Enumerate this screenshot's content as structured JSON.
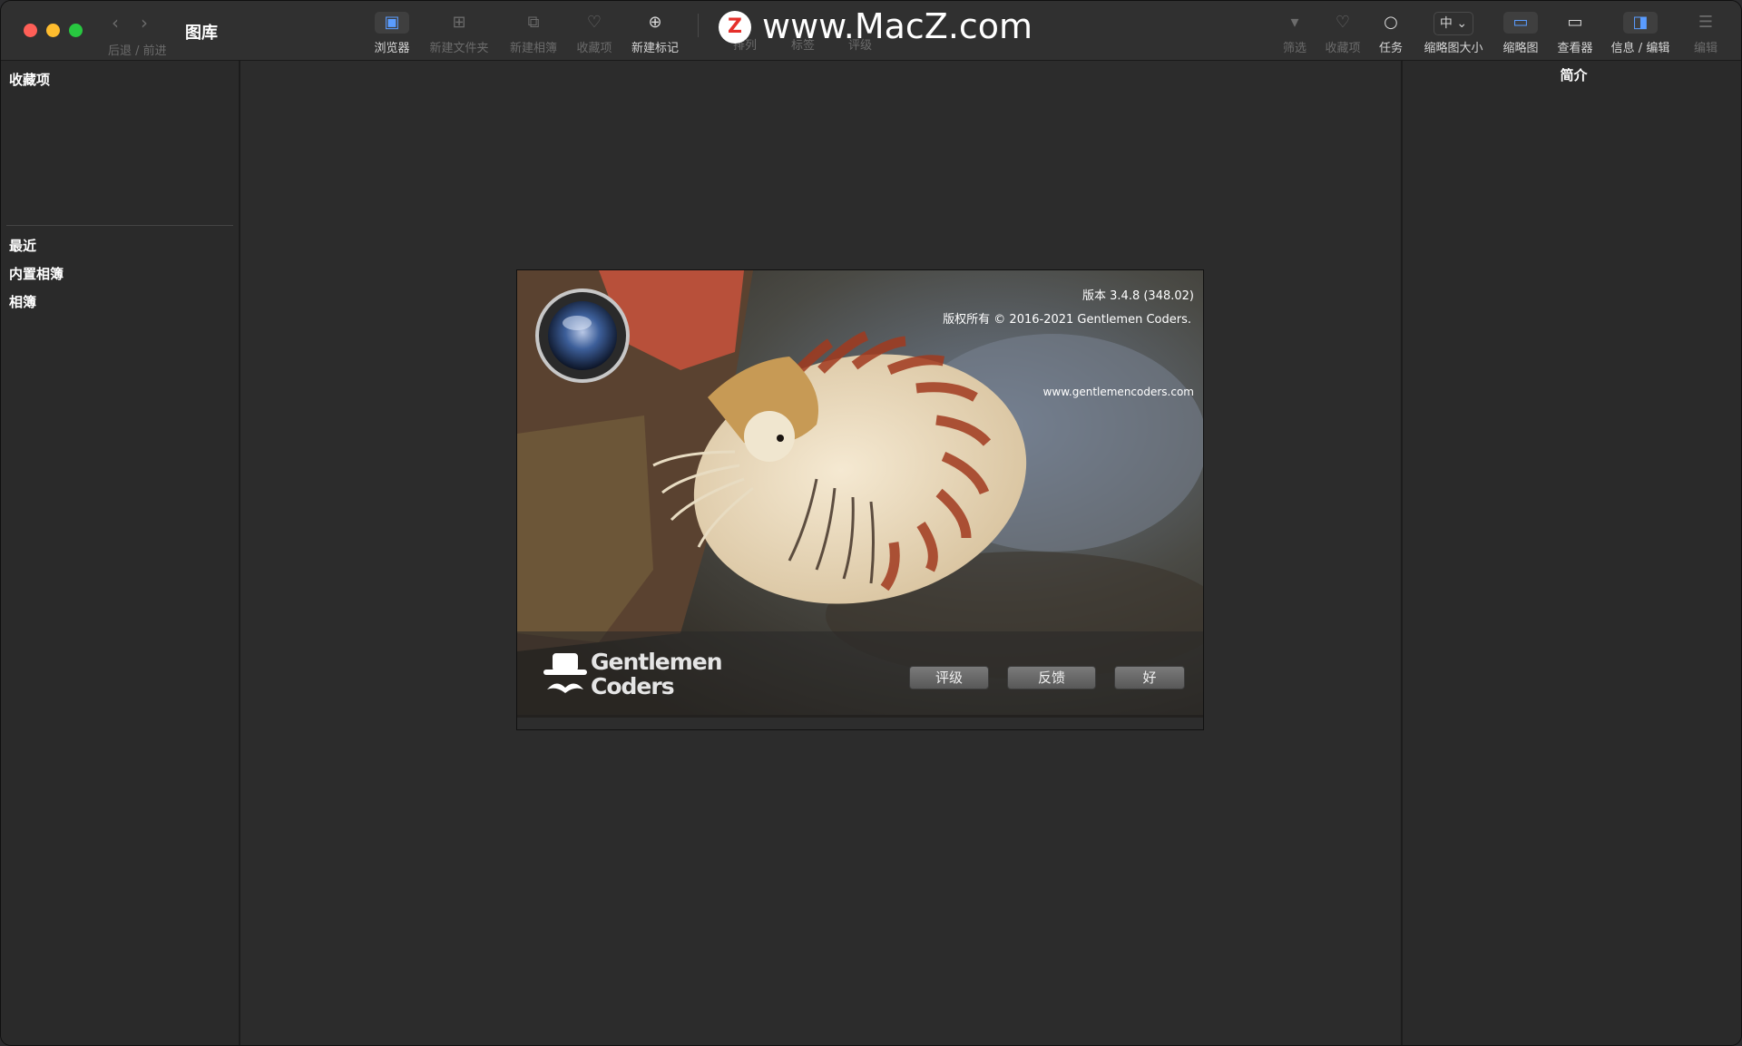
{
  "window": {
    "title": "图库",
    "nav_label": "后退 / 前进",
    "back_glyph": "‹",
    "forward_glyph": "›"
  },
  "toolbar": {
    "browser": "浏览器",
    "new_folder": "新建文件夹",
    "new_album": "新建相簿",
    "favorites": "收藏项",
    "new_tag": "新建标记",
    "sort": "排列",
    "tags": "标签",
    "rating": "评级",
    "filter": "筛选",
    "favorites_right": "收藏项",
    "tasks": "任务",
    "thumb_size_label": "缩略图大小",
    "thumb_size_value": "中",
    "thumbnails": "缩略图",
    "viewer": "查看器",
    "info_edit": "信息 / 编辑",
    "edit": "编辑"
  },
  "watermark": {
    "logo": "Z",
    "text": "www.MacZ.com"
  },
  "sidebar": {
    "header": "收藏项",
    "items": [
      "最近",
      "内置相簿",
      "相簿"
    ]
  },
  "inspector": {
    "title": "简介"
  },
  "splash": {
    "version": "版本 3.4.8 (348.02)",
    "copyright": "版权所有 © 2016-2021 Gentlemen Coders.",
    "website": "www.gentlemencoders.com",
    "brand_line1": "Gentlemen",
    "brand_line2": "Coders",
    "buttons": {
      "rate": "评级",
      "feedback": "反馈",
      "ok": "好"
    }
  },
  "colors": {
    "accent": "#5a9cff",
    "window_bg": "#2a2a2a",
    "close": "#ff5f57",
    "minimize": "#febc2e",
    "maximize": "#28c840"
  }
}
